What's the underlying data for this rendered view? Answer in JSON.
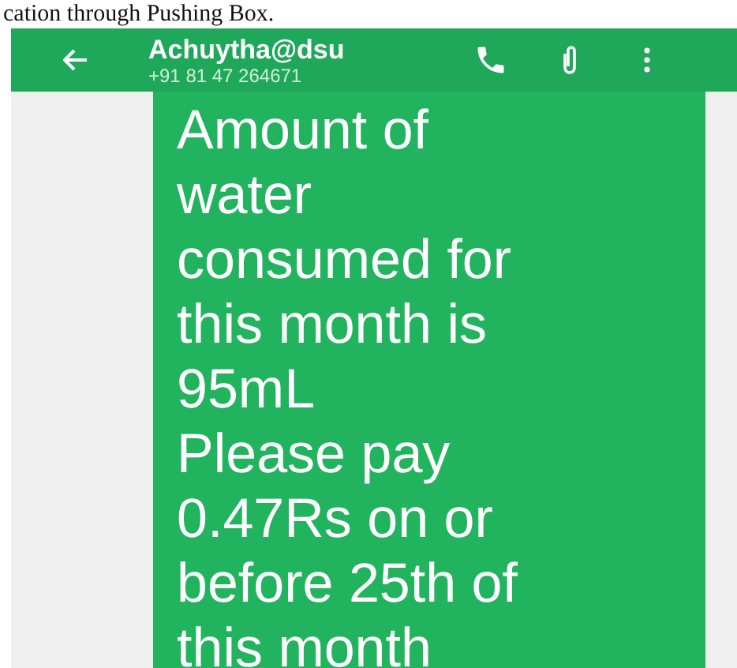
{
  "document_text": "cation through Pushing Box.",
  "header": {
    "contact_name": "Achuytha@dsu",
    "phone_number": "+91 81 47 264671"
  },
  "message": {
    "text": "Amount of\nwater\nconsumed for\nthis month is\n95mL\nPlease pay\n0.47Rs on or\nbefore 25th of\nthis month"
  }
}
